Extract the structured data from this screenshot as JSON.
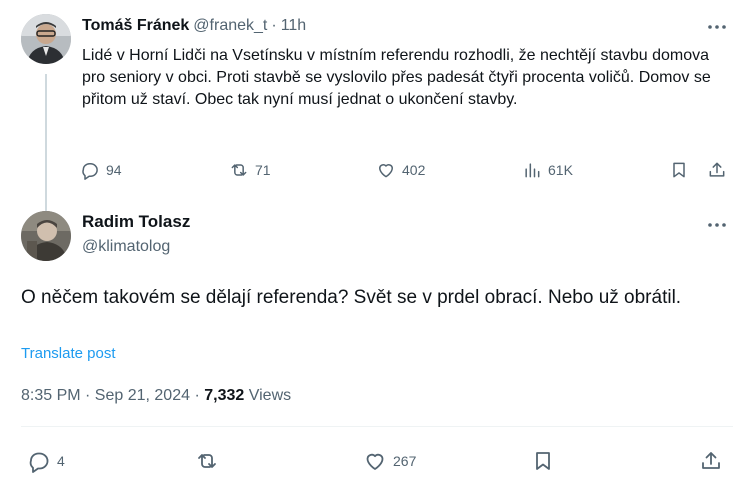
{
  "parent_tweet": {
    "author_name": "Tomáš Fránek",
    "handle": "@franek_t",
    "separator": "·",
    "time_ago": "11h",
    "text": "Lidé v Horní Lidči na Vsetínsku v místním referendu rozhodli, že nechtějí stavbu domova pro seniory v obci. Proti stavbě se vyslovilo přes padesát čtyři procenta voličů. Domov se přitom už staví. Obec tak nyní musí jednat o ukončení stavby.",
    "actions": {
      "replies": "94",
      "reposts": "71",
      "likes": "402",
      "views": "61K"
    }
  },
  "main_tweet": {
    "author_name": "Radim Tolasz",
    "handle": "@klimatolog",
    "text": "O něčem takovém se dělají referenda? Svět se v prdel obrací. Nebo už obrátil.",
    "translate_label": "Translate post",
    "time": "8:35 PM · Sep 21, 2024",
    "meta_separator": "·",
    "views_count": "7,332",
    "views_label": "Views",
    "actions": {
      "replies": "4",
      "reposts": "",
      "likes": "267"
    }
  },
  "icons": {
    "more": "more-horizontal-icon",
    "reply": "reply-icon",
    "repost": "repost-icon",
    "like": "heart-icon",
    "views": "views-chart-icon",
    "bookmark": "bookmark-icon",
    "share": "share-icon"
  },
  "colors": {
    "text": "#0f1419",
    "secondary": "#536471",
    "link": "#1d9bf0",
    "divider": "#eff3f4",
    "thread_line": "#cfd9de"
  }
}
